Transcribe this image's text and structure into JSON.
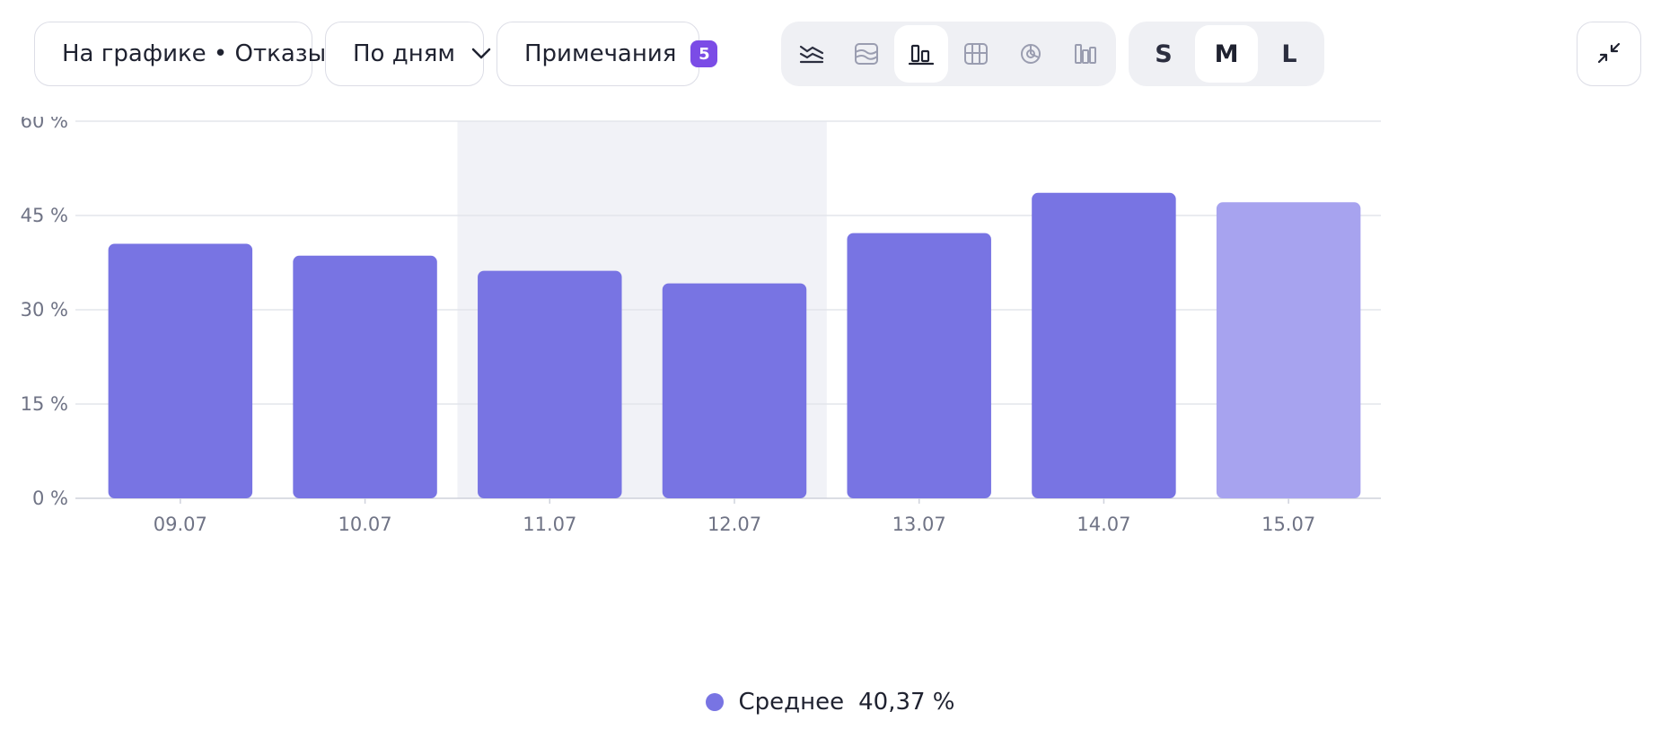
{
  "toolbar": {
    "metric_select": {
      "label": "На графике • Отказы"
    },
    "period_select": {
      "label": "По дням"
    },
    "notes_button": {
      "label": "Примечания",
      "count": "5"
    },
    "chart_types": [
      {
        "icon": "stacked-lines-icon",
        "active": false
      },
      {
        "icon": "area-chart-icon",
        "active": false
      },
      {
        "icon": "column-chart-icon",
        "active": true
      },
      {
        "icon": "table-chart-icon",
        "active": false
      },
      {
        "icon": "pie-chart-icon",
        "active": false
      },
      {
        "icon": "bar-chart-icon",
        "active": false
      }
    ],
    "sizes": [
      {
        "label": "S",
        "active": false
      },
      {
        "label": "M",
        "active": true
      },
      {
        "label": "L",
        "active": false
      }
    ],
    "collapse_icon": "collapse-icon"
  },
  "chart_data": {
    "type": "bar",
    "categories": [
      "09.07",
      "10.07",
      "11.07",
      "12.07",
      "13.07",
      "14.07",
      "15.07"
    ],
    "series": [
      {
        "name": "Среднее",
        "values": [
          40.5,
          38.6,
          36.2,
          34.2,
          42.2,
          48.6,
          47.1
        ]
      }
    ],
    "ylim": [
      0,
      60
    ],
    "yticks": [
      0,
      15,
      30,
      45,
      60
    ],
    "ytick_labels": [
      "0 %",
      "15 %",
      "30 %",
      "45 %",
      "60 %"
    ],
    "grid": true,
    "highlighted_categories": [
      "11.07",
      "12.07"
    ],
    "partial_categories": [
      "15.07"
    ],
    "legend_position": "bottom-center"
  },
  "legend": {
    "label": "Среднее",
    "value": "40,37 %"
  },
  "colors": {
    "bar": "#7874e3",
    "bar_partial": "#a7a3ef",
    "highlight_band": "#f1f2f7",
    "grid": "#e3e5ec",
    "axis_text": "#6f7385",
    "badge": "#7b4ce6"
  }
}
